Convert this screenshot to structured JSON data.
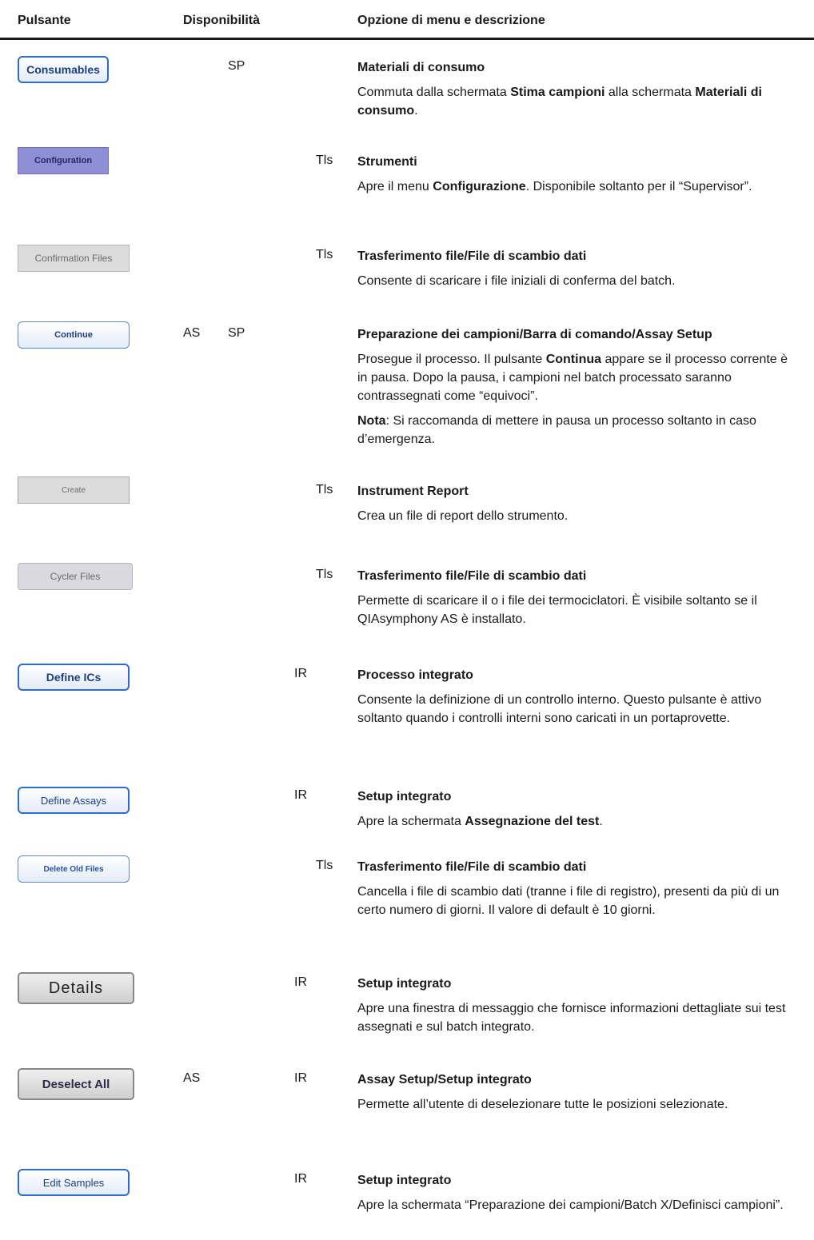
{
  "header": {
    "col_button": "Pulsante",
    "col_availability": "Disponibilità",
    "col_menu": "Opzione di menu e descrizione"
  },
  "rows": [
    {
      "button": "Consumables",
      "avail_as": "",
      "avail_sp": "SP",
      "avail_ir": "",
      "avail_tls": "",
      "title": "Materiali di consumo",
      "para1": [
        "Commuta dalla schermata ",
        "Stima campioni",
        " alla schermata ",
        "Materiali di consumo",
        "."
      ]
    },
    {
      "button": "Configuration",
      "avail_as": "",
      "avail_sp": "",
      "avail_ir": "",
      "avail_tls": "Tls",
      "title": "Strumenti",
      "para1": [
        "Apre il menu ",
        "Configurazione",
        ". Disponibile soltanto per il “Supervisor”."
      ]
    },
    {
      "button": "Confirmation Files",
      "avail_as": "",
      "avail_sp": "",
      "avail_ir": "",
      "avail_tls": "Tls",
      "title": "Trasferimento file/File di scambio dati",
      "para1": [
        "Consente di scaricare i file iniziali di conferma del batch."
      ]
    },
    {
      "button": "Continue",
      "avail_as": "AS",
      "avail_sp": "SP",
      "avail_ir": "",
      "avail_tls": "",
      "title": "Preparazione dei campioni/Barra di comando/Assay Setup",
      "para1": [
        "Prosegue il processo. Il pulsante ",
        "Continua",
        " appare se il processo corrente è in pausa. Dopo la pausa, i campioni nel batch processato saranno contrassegnati come “equivoci”."
      ],
      "para2": [
        "Nota",
        ": Si raccomanda di mettere in pausa un processo soltanto in caso d’emergenza."
      ]
    },
    {
      "button": "Create",
      "avail_as": "",
      "avail_sp": "",
      "avail_ir": "",
      "avail_tls": "Tls",
      "title": "Instrument Report",
      "para1": [
        "Crea un file di report dello strumento."
      ]
    },
    {
      "button": "Cycler Files",
      "avail_as": "",
      "avail_sp": "",
      "avail_ir": "",
      "avail_tls": "Tls",
      "title": "Trasferimento file/File di scambio dati",
      "para1": [
        "Permette di scaricare il o i file dei termociclatori. È visibile soltanto se il QIAsymphony AS è installato."
      ]
    },
    {
      "button": "Define ICs",
      "avail_as": "",
      "avail_sp": "",
      "avail_ir": "IR",
      "avail_tls": "",
      "title": "Processo integrato",
      "para1": [
        "Consente la definizione di un controllo interno. Questo pulsante è attivo soltanto quando i controlli interni sono caricati in un portaprovette."
      ]
    },
    {
      "button": "Define Assays",
      "avail_as": "",
      "avail_sp": "",
      "avail_ir": "IR",
      "avail_tls": "",
      "title": "Setup integrato",
      "para1": [
        "Apre la schermata ",
        "Assegnazione del test",
        "."
      ]
    },
    {
      "button": "Delete Old Files",
      "avail_as": "",
      "avail_sp": "",
      "avail_ir": "",
      "avail_tls": "Tls",
      "title": "Trasferimento file/File di scambio dati",
      "para1": [
        "Cancella i file di scambio dati (tranne i file di registro), presenti da più di un certo numero di giorni. Il valore di default è 10 giorni."
      ]
    },
    {
      "button": "Details",
      "avail_as": "",
      "avail_sp": "",
      "avail_ir": "IR",
      "avail_tls": "",
      "title": "Setup integrato",
      "para1": [
        "Apre una finestra di messaggio che fornisce informazioni dettagliate sui test assegnati e sul batch integrato."
      ]
    },
    {
      "button": "Deselect All",
      "avail_as": "AS",
      "avail_sp": "",
      "avail_ir": "IR",
      "avail_tls": "",
      "title": "Assay Setup/Setup integrato",
      "para1": [
        "Permette all’utente di deselezionare tutte le posizioni selezionate."
      ]
    },
    {
      "button": "Edit Samples",
      "avail_as": "",
      "avail_sp": "",
      "avail_ir": "IR",
      "avail_tls": "",
      "title": "Setup integrato",
      "para1": [
        "Apre la schermata “Preparazione dei campioni/Batch X/Definisci campioni”."
      ]
    }
  ]
}
